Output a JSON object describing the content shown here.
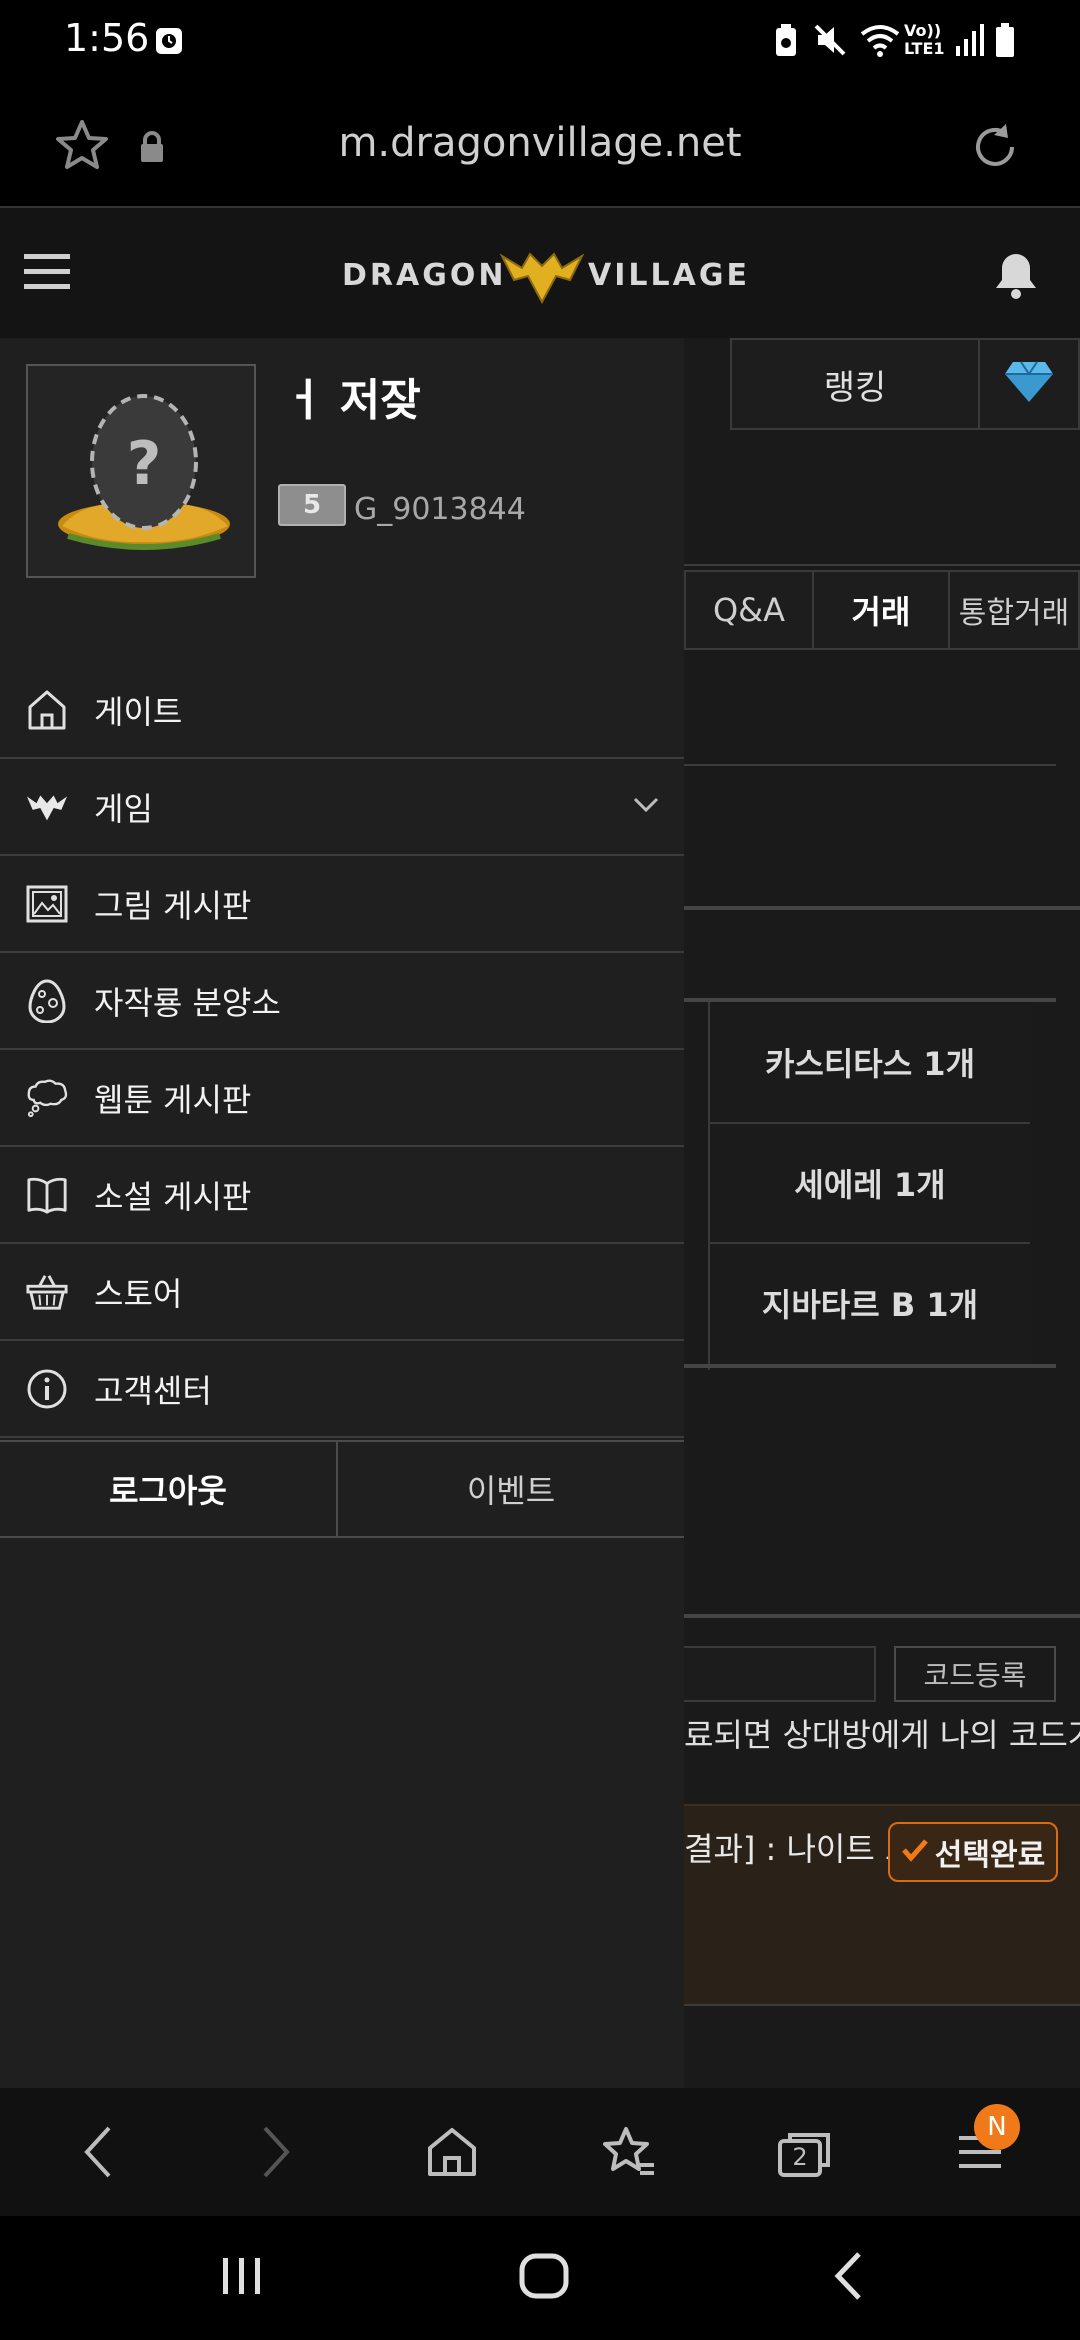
{
  "status_bar": {
    "time": "1:56",
    "network_label": "Vo)) LTE1"
  },
  "browser": {
    "url": "m.dragonvillage.net",
    "tabs_count": "2",
    "menu_badge": "N"
  },
  "header": {
    "logo_left": "DRAGON",
    "logo_right": "VILLAGE"
  },
  "background_page": {
    "tabs": [
      "랭킹"
    ],
    "sub_tabs": [
      "Q&A",
      "거래",
      "통합거래"
    ],
    "trade_items": [
      "카스티타스 1개",
      "세에레 1개",
      "지바타르 B 1개"
    ],
    "code_button": "코드등록",
    "code_note": "료되면 상대방에게 나의 코드가",
    "result_text": "결과] : 나이트 드",
    "select_button": "선택완료"
  },
  "profile": {
    "name": "ㅓ 저잦",
    "level": "5",
    "id": "G_9013844"
  },
  "menu": {
    "items": [
      {
        "label": "게이트",
        "icon": "home-icon"
      },
      {
        "label": "게임",
        "icon": "dragon-wings-icon"
      },
      {
        "label": "그림 게시판",
        "icon": "picture-icon"
      },
      {
        "label": "자작룡 분양소",
        "icon": "egg-icon"
      },
      {
        "label": "웹툰 게시판",
        "icon": "thought-bubble-icon"
      },
      {
        "label": "소설 게시판",
        "icon": "book-icon"
      },
      {
        "label": "스토어",
        "icon": "basket-icon"
      },
      {
        "label": "고객센터",
        "icon": "info-icon"
      }
    ]
  },
  "footer": {
    "logout": "로그아웃",
    "event": "이벤트"
  },
  "colors": {
    "accent": "#f07a1a",
    "logo_gold": "#e0b020",
    "diamond": "#3a9ad0"
  }
}
